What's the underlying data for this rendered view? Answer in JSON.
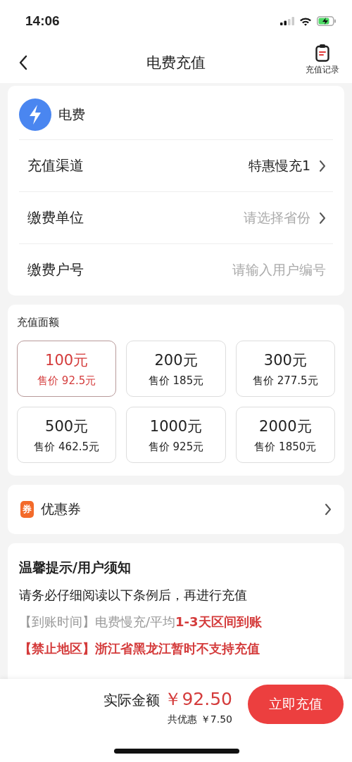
{
  "status_bar": {
    "time": "14:06"
  },
  "nav": {
    "title": "电费充值",
    "record_label": "充值记录"
  },
  "account": {
    "title": "电费",
    "rows": [
      {
        "label": "充值渠道",
        "value": "特惠慢充1",
        "kind": "select"
      },
      {
        "label": "缴费单位",
        "placeholder": "请选择省份",
        "kind": "select"
      },
      {
        "label": "缴费户号",
        "placeholder": "请输入用户编号",
        "kind": "input"
      }
    ]
  },
  "amounts": {
    "title": "充值面额",
    "options": [
      {
        "amount": "100元",
        "price": "售价 92.5元",
        "selected": true
      },
      {
        "amount": "200元",
        "price": "售价 185元",
        "selected": false
      },
      {
        "amount": "300元",
        "price": "售价 277.5元",
        "selected": false
      },
      {
        "amount": "500元",
        "price": "售价 462.5元",
        "selected": false
      },
      {
        "amount": "1000元",
        "price": "售价 925元",
        "selected": false
      },
      {
        "amount": "2000元",
        "price": "售价 1850元",
        "selected": false
      }
    ]
  },
  "coupon": {
    "badge": "券",
    "label": "优惠券"
  },
  "notice": {
    "title": "温馨提示/用户须知",
    "intro": "请务必仔细阅读以下条例后，再进行充值",
    "lines": [
      {
        "text": "【到账时间】电费慢充/平均**1-3天区间到账**",
        "kind": "normal"
      },
      {
        "text": "【禁止地区】浙江省黑龙江暂时不支持充值",
        "kind": "warning"
      }
    ]
  },
  "footer": {
    "total_label": "实际金额",
    "total": "￥92.50",
    "discount": "共优惠 ￥7.50",
    "button": "立即充值"
  }
}
